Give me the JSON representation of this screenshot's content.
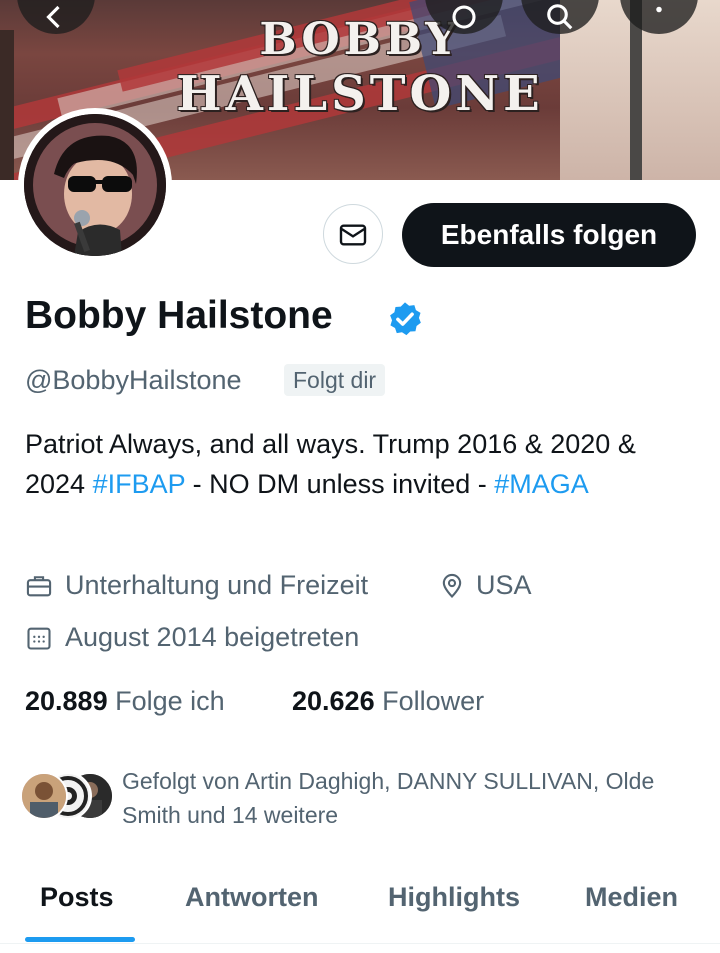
{
  "banner": {
    "line1": "BOBBY",
    "line2": "HAILSTONE"
  },
  "top_bar": {
    "icons": [
      "back-arrow-icon",
      "grok-icon",
      "search-icon",
      "more-icon"
    ]
  },
  "profile": {
    "name": "Bobby Hailstone",
    "handle": "@BobbyHailstone",
    "follows_you": "Folgt dir",
    "follow_button": "Ebenfalls folgen",
    "verified_color": "#1d9bf0",
    "bio": {
      "part1": "Patriot Always, and all ways. Trump 2016 & 2020 & 2024 ",
      "hashtag1": "#IFBAP",
      "part2": " - NO DM unless invited - ",
      "hashtag2": "#MAGA"
    },
    "category": "Unterhaltung und Freizeit",
    "location": "USA",
    "joined": "August 2014 beigetreten",
    "following_count": "20.889",
    "following_label": "Folge ich",
    "followers_count": "20.626",
    "followers_label": "Follower",
    "followed_by": "Gefolgt von Artin Daghigh, DANNY SULLIVAN, Olde Smith und 14 weitere"
  },
  "tabs": [
    {
      "label": "Posts"
    },
    {
      "label": "Antworten"
    },
    {
      "label": "Highlights"
    },
    {
      "label": "Medien"
    }
  ],
  "colors": {
    "accent": "#1d9bf0",
    "text_primary": "#0f1419",
    "text_secondary": "#536471"
  }
}
